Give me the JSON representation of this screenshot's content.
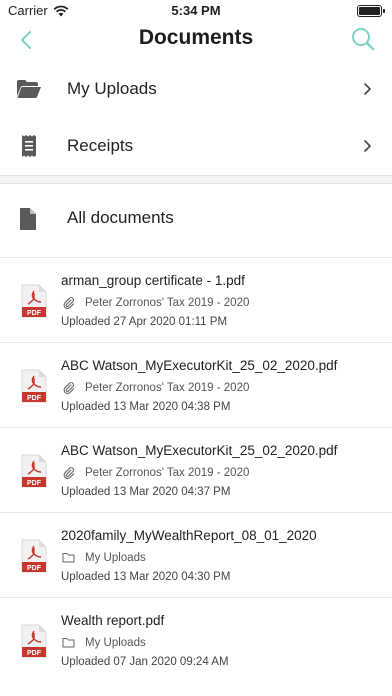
{
  "status": {
    "carrier": "Carrier",
    "time": "5:34 PM"
  },
  "nav": {
    "title": "Documents"
  },
  "menu": [
    {
      "label": "My Uploads",
      "icon": "folder-open-icon"
    },
    {
      "label": "Receipts",
      "icon": "receipt-icon"
    }
  ],
  "all_documents": {
    "label": "All documents",
    "icon": "document-icon"
  },
  "documents": [
    {
      "name": "arman_group certificate - 1.pdf",
      "location": "Peter Zorronos' Tax 2019 - 2020",
      "location_icon": "paperclip-icon",
      "uploaded": "Uploaded 27 Apr 2020 01:11 PM",
      "badge": "PDF"
    },
    {
      "name": "ABC Watson_MyExecutorKit_25_02_2020.pdf",
      "location": "Peter Zorronos' Tax 2019 - 2020",
      "location_icon": "paperclip-icon",
      "uploaded": "Uploaded 13 Mar 2020 04:38 PM",
      "badge": "PDF"
    },
    {
      "name": "ABC Watson_MyExecutorKit_25_02_2020.pdf",
      "location": "Peter Zorronos' Tax 2019 - 2020",
      "location_icon": "paperclip-icon",
      "uploaded": "Uploaded 13 Mar 2020 04:37 PM",
      "badge": "PDF"
    },
    {
      "name": "2020family_MyWealthReport_08_01_2020",
      "location": "My Uploads",
      "location_icon": "folder-icon",
      "uploaded": "Uploaded 13 Mar 2020 04:30 PM",
      "badge": "PDF"
    },
    {
      "name": "Wealth report.pdf",
      "location": "My Uploads",
      "location_icon": "folder-icon",
      "uploaded": "Uploaded 07 Jan 2020 09:24 AM",
      "badge": "PDF"
    }
  ],
  "colors": {
    "accent": "#7fd3c3",
    "pdf_red": "#c8372d",
    "icon_gray": "#5a5a5a"
  }
}
